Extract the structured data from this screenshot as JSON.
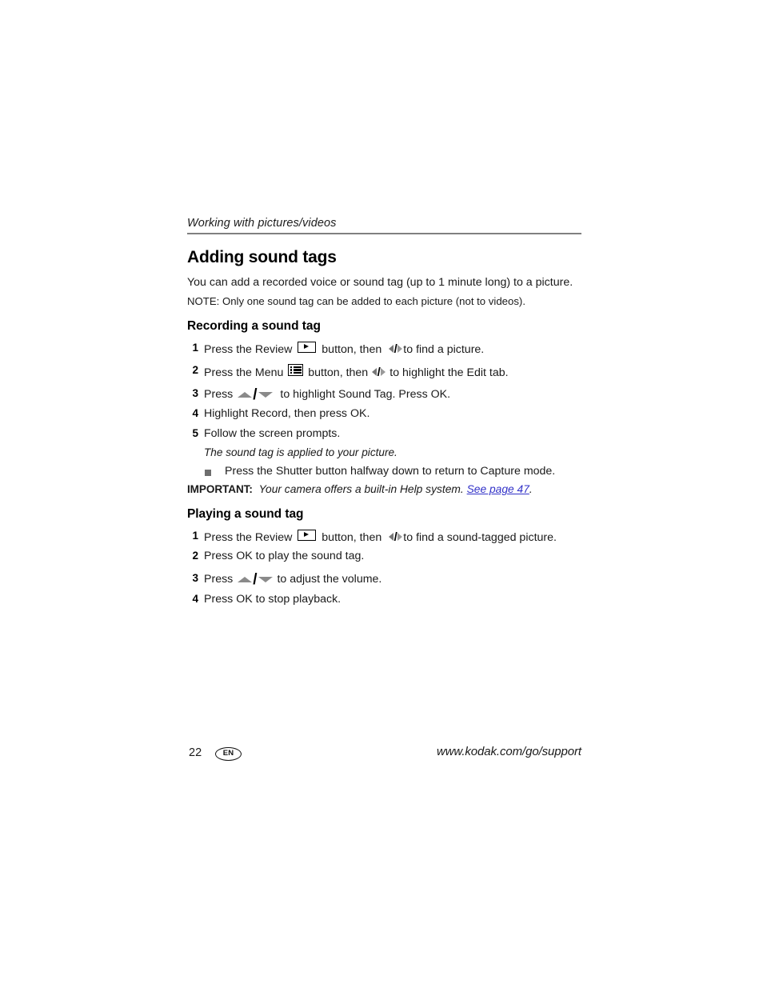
{
  "document": {
    "running_head": "Working with pictures/videos",
    "title": "Adding sound tags",
    "intro": "You can add a recorded voice or sound tag (up to 1 minute long) to a picture.",
    "note": "NOTE:  Only one sound tag can be added to each picture (not to videos)."
  },
  "sections": [
    {
      "heading": "Recording a sound tag",
      "steps": [
        {
          "num": "1",
          "pre": "Press the Review ",
          "icon": "review-button-icon",
          "mid": " button, then  ",
          "icon2": "left-right-arrows-icon",
          "post": "to find a picture."
        },
        {
          "num": "2",
          "pre": "Press the Menu ",
          "icon": "menu-button-icon",
          "mid": " button, then ",
          "icon2": "left-right-arrows-icon",
          "post": " to highlight the Edit tab."
        },
        {
          "num": "3",
          "pre": "Press ",
          "icon": "up-down-arrows-icon",
          "mid": "",
          "icon2": "",
          "post": "  to highlight Sound Tag. Press OK."
        },
        {
          "num": "4",
          "pre": "Highlight Record, then press OK.",
          "icon": "",
          "mid": "",
          "icon2": "",
          "post": ""
        },
        {
          "num": "5",
          "pre": "Follow the screen prompts.",
          "icon": "",
          "mid": "",
          "icon2": "",
          "post": ""
        }
      ],
      "result_text": "The sound tag is applied to your picture.",
      "bullet_text": "Press the Shutter button halfway down to return to Capture mode."
    },
    {
      "heading": "Playing a sound tag",
      "steps": [
        {
          "num": "1",
          "pre": "Press the Review ",
          "icon": "review-button-icon",
          "mid": " button, then  ",
          "icon2": "left-right-arrows-icon",
          "post": "to find a sound-tagged picture."
        },
        {
          "num": "2",
          "pre": "Press OK to play the sound tag.",
          "icon": "",
          "mid": "",
          "icon2": "",
          "post": ""
        },
        {
          "num": "3",
          "pre": "Press ",
          "icon": "up-down-arrows-icon",
          "mid": "",
          "icon2": "",
          "post": " to adjust the volume."
        },
        {
          "num": "4",
          "pre": "Press OK to stop playback.",
          "icon": "",
          "mid": "",
          "icon2": "",
          "post": ""
        }
      ]
    }
  ],
  "important": {
    "label": "IMPORTANT:",
    "text": "Your camera offers a built-in Help system.",
    "link_text": "See page 47",
    "link_suffix": ".",
    "link_color": "#3232c8"
  },
  "footer": {
    "page_number": "22",
    "language_badge": "EN",
    "url": "www.kodak.com/go/support"
  }
}
